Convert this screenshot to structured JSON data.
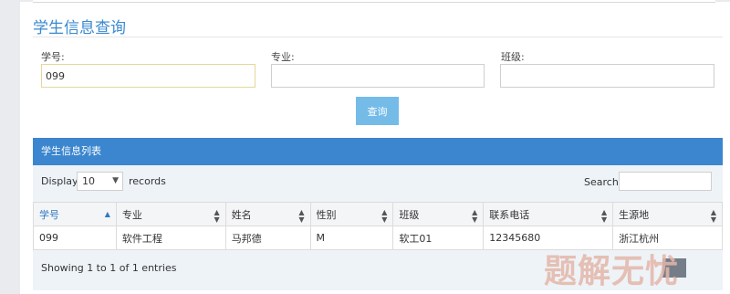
{
  "page": {
    "title": "学生信息查询"
  },
  "form": {
    "student_id_label": "学号:",
    "student_id_value": "099",
    "major_label": "专业:",
    "major_value": "",
    "class_label": "班级:",
    "class_value": "",
    "query_button": "查询"
  },
  "panel": {
    "title": "学生信息列表"
  },
  "table_controls": {
    "display_label": "Display",
    "page_length": "10",
    "records_label": "records",
    "search_label": "Search:",
    "search_value": ""
  },
  "table": {
    "columns": [
      "学号",
      "专业",
      "姓名",
      "性别",
      "班级",
      "联系电话",
      "生源地"
    ],
    "rows": [
      [
        "099",
        "软件工程",
        "马邦德",
        "M",
        "软工01",
        "12345680",
        "浙江杭州"
      ]
    ]
  },
  "info": "Showing 1 to 1 of 1 entries",
  "watermark": "题解无忧",
  "colors": {
    "accent": "#3b86cf",
    "button": "#74bbe8",
    "title": "#3a8ad0"
  }
}
